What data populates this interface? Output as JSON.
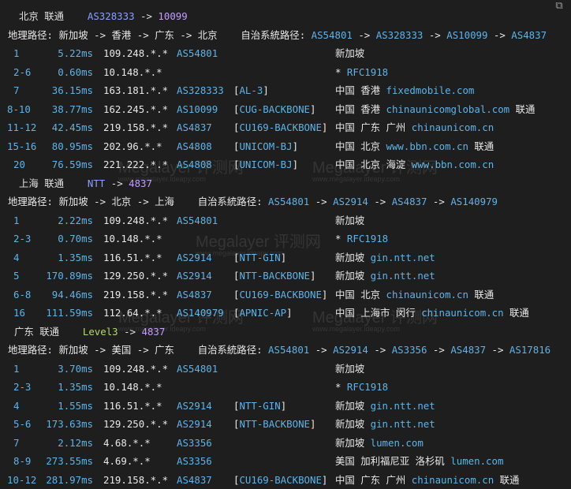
{
  "window": {
    "corner_icon": "copy-icon"
  },
  "colors": {
    "background": "#1e1e1e",
    "accent": "#5fb3e8",
    "as_header": "#8aa0ff",
    "asn_purple": "#c49cff",
    "level3_green": "#b5d86a"
  },
  "watermark": {
    "title": "Megalayer 评测网",
    "subtitle": "www.megalayer.ldeapy.com"
  },
  "sections": [
    {
      "header": {
        "name": "北京 联通",
        "as": "AS328333",
        "arrow": "->",
        "asn": "10099"
      },
      "geo_path": "地理路径: 新加坡 -> 香港 -> 广东 -> 北京",
      "as_path_label": "自治系統路径:",
      "as_path": [
        "AS54801",
        "AS328333",
        "AS10099",
        "AS4837"
      ],
      "hops": [
        {
          "hop": "1",
          "lat": "5.22ms",
          "ip": "109.248.*.*",
          "as": "AS54801",
          "net": "",
          "geo": "新加坡",
          "dom": "",
          "tail": ""
        },
        {
          "hop": "2-6",
          "lat": "0.60ms",
          "ip": "10.148.*.*",
          "as": "",
          "net": "",
          "geo": "* ",
          "dom": "RFC1918",
          "tail": ""
        },
        {
          "hop": "7",
          "lat": "36.15ms",
          "ip": "163.181.*.*",
          "as": "AS328333",
          "net": "AL-3",
          "geo": "中国 香港 ",
          "dom": "fixedmobile.com",
          "tail": ""
        },
        {
          "hop": "8-10",
          "lat": "38.77ms",
          "ip": "162.245.*.*",
          "as": "AS10099",
          "net": "CUG-BACKBONE",
          "geo": "中国 香港 ",
          "dom": "chinaunicomglobal.com",
          "tail": " 联通"
        },
        {
          "hop": "11-12",
          "lat": "42.45ms",
          "ip": "219.158.*.*",
          "as": "AS4837",
          "net": "CU169-BACKBONE",
          "geo": "中国 广东 广州 ",
          "dom": "chinaunicom.cn",
          "tail": ""
        },
        {
          "hop": "15-16",
          "lat": "80.95ms",
          "ip": "202.96.*.*",
          "as": "AS4808",
          "net": "UNICOM-BJ",
          "geo": "中国 北京 ",
          "dom": "www.bbn.com.cn",
          "tail": " 联通"
        },
        {
          "hop": "20",
          "lat": "76.59ms",
          "ip": "221.222.*.*",
          "as": "AS4808",
          "net": "UNICOM-BJ",
          "geo": "中国 北京 海淀 ",
          "dom": "www.bbn.com.cn",
          "tail": ""
        }
      ]
    },
    {
      "header": {
        "name": "上海 联通",
        "as": "NTT",
        "arrow": "->",
        "asn": "4837"
      },
      "geo_path": "地理路径: 新加坡 -> 北京 -> 上海",
      "as_path_label": "自治系統路径:",
      "as_path": [
        "AS54801",
        "AS2914",
        "AS4837",
        "AS140979"
      ],
      "hops": [
        {
          "hop": "1",
          "lat": "2.22ms",
          "ip": "109.248.*.*",
          "as": "AS54801",
          "net": "",
          "geo": "新加坡",
          "dom": "",
          "tail": ""
        },
        {
          "hop": "2-3",
          "lat": "0.70ms",
          "ip": "10.148.*.*",
          "as": "",
          "net": "",
          "geo": "* ",
          "dom": "RFC1918",
          "tail": ""
        },
        {
          "hop": "4",
          "lat": "1.35ms",
          "ip": "116.51.*.*",
          "as": "AS2914",
          "net": "NTT-GIN",
          "geo": "新加坡 ",
          "dom": "gin.ntt.net",
          "tail": ""
        },
        {
          "hop": "5",
          "lat": "170.89ms",
          "ip": "129.250.*.*",
          "as": "AS2914",
          "net": "NTT-BACKBONE",
          "geo": "新加坡 ",
          "dom": "gin.ntt.net",
          "tail": ""
        },
        {
          "hop": "6-8",
          "lat": "94.46ms",
          "ip": "219.158.*.*",
          "as": "AS4837",
          "net": "CU169-BACKBONE",
          "geo": "中国 北京 ",
          "dom": "chinaunicom.cn",
          "tail": " 联通"
        },
        {
          "hop": "16",
          "lat": "111.59ms",
          "ip": "112.64.*.*",
          "as": "AS140979",
          "net": "APNIC-AP",
          "geo": "中国 上海市 闵行 ",
          "dom": "chinaunicom.cn",
          "tail": " 联通"
        }
      ]
    },
    {
      "header": {
        "name": "广东 联通",
        "as": "Level3",
        "arrow": "->",
        "asn": "4837"
      },
      "geo_path": "地理路径: 新加坡 -> 美国 -> 广东",
      "as_path_label": "自治系統路径:",
      "as_path": [
        "AS54801",
        "AS2914",
        "AS3356",
        "AS4837",
        "AS17816"
      ],
      "hops": [
        {
          "hop": "1",
          "lat": "3.70ms",
          "ip": "109.248.*.*",
          "as": "AS54801",
          "net": "",
          "geo": "新加坡",
          "dom": "",
          "tail": ""
        },
        {
          "hop": "2-3",
          "lat": "1.35ms",
          "ip": "10.148.*.*",
          "as": "",
          "net": "",
          "geo": "* ",
          "dom": "RFC1918",
          "tail": ""
        },
        {
          "hop": "4",
          "lat": "1.55ms",
          "ip": "116.51.*.*",
          "as": "AS2914",
          "net": "NTT-GIN",
          "geo": "新加坡 ",
          "dom": "gin.ntt.net",
          "tail": ""
        },
        {
          "hop": "5-6",
          "lat": "173.63ms",
          "ip": "129.250.*.*",
          "as": "AS2914",
          "net": "NTT-BACKBONE",
          "geo": "新加坡 ",
          "dom": "gin.ntt.net",
          "tail": ""
        },
        {
          "hop": "7",
          "lat": "2.12ms",
          "ip": "4.68.*.*",
          "as": "AS3356",
          "net": "",
          "geo": "新加坡 ",
          "dom": "lumen.com",
          "tail": ""
        },
        {
          "hop": "8-9",
          "lat": "273.55ms",
          "ip": "4.69.*.*",
          "as": "AS3356",
          "net": "",
          "geo": "美国 加利福尼亚 洛杉矶 ",
          "dom": "lumen.com",
          "tail": ""
        },
        {
          "hop": "10-12",
          "lat": "281.97ms",
          "ip": "219.158.*.*",
          "as": "AS4837",
          "net": "CU169-BACKBONE",
          "geo": "中国 广东 广州 ",
          "dom": "chinaunicom.cn",
          "tail": " 联通"
        }
      ]
    }
  ]
}
